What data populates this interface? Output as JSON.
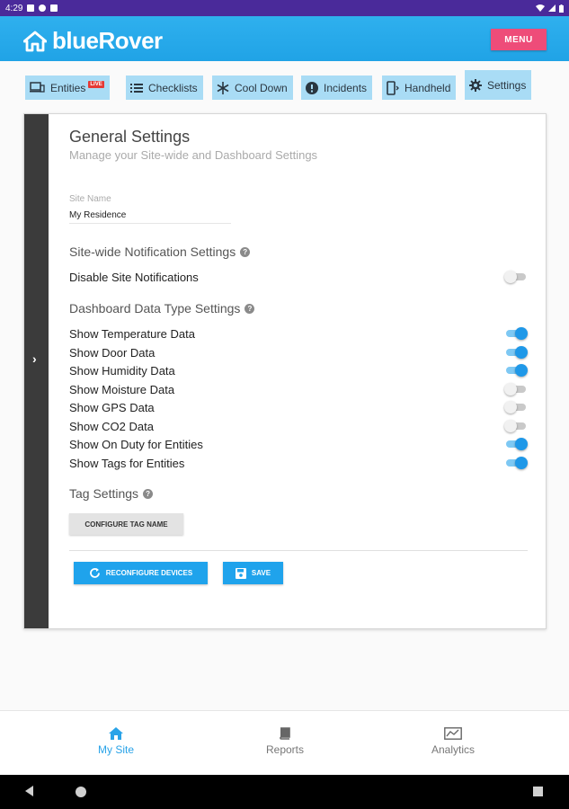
{
  "status_bar": {
    "time": "4:29"
  },
  "app_bar": {
    "brand": "blueRover",
    "menu_label": "MENU"
  },
  "tabs": [
    {
      "label": "Entities",
      "badge": "LIVE",
      "icon": "devices-icon"
    },
    {
      "label": "Checklists",
      "icon": "checklist-icon"
    },
    {
      "label": "Cool Down",
      "icon": "snowflake-icon"
    },
    {
      "label": "Incidents",
      "icon": "alert-icon"
    },
    {
      "label": "Handheld",
      "icon": "handheld-icon"
    },
    {
      "label": "Settings",
      "icon": "gear-icon",
      "active": true
    }
  ],
  "settings": {
    "title": "General Settings",
    "subtitle": "Manage your Site-wide and Dashboard Settings",
    "site_name_label": "Site Name",
    "site_name_value": "My Residence",
    "notification_heading": "Site-wide Notification Settings",
    "disable_notifications_label": "Disable Site Notifications",
    "disable_notifications_on": false,
    "datatype_heading": "Dashboard Data Type Settings",
    "data_types": [
      {
        "label": "Show Temperature Data",
        "on": true
      },
      {
        "label": "Show Door Data",
        "on": true
      },
      {
        "label": "Show Humidity Data",
        "on": true
      },
      {
        "label": "Show Moisture Data",
        "on": false
      },
      {
        "label": "Show GPS Data",
        "on": false
      },
      {
        "label": "Show CO2 Data",
        "on": false
      },
      {
        "label": "Show On Duty for Entities",
        "on": true
      },
      {
        "label": "Show Tags for Entities",
        "on": true
      }
    ],
    "tag_heading": "Tag Settings",
    "configure_tag_label": "CONFIGURE TAG NAME",
    "reconfigure_label": "RECONFIGURE DEVICES",
    "save_label": "SAVE"
  },
  "bottom_nav": [
    {
      "label": "My Site",
      "icon": "home-icon",
      "active": true
    },
    {
      "label": "Reports",
      "icon": "book-icon"
    },
    {
      "label": "Analytics",
      "icon": "analytics-icon"
    }
  ],
  "colors": {
    "brand_blue": "#20a3e6",
    "menu_pink": "#ee4c79",
    "toggle_on": "#1f98e8",
    "tab_bg": "#a9dcf5"
  }
}
